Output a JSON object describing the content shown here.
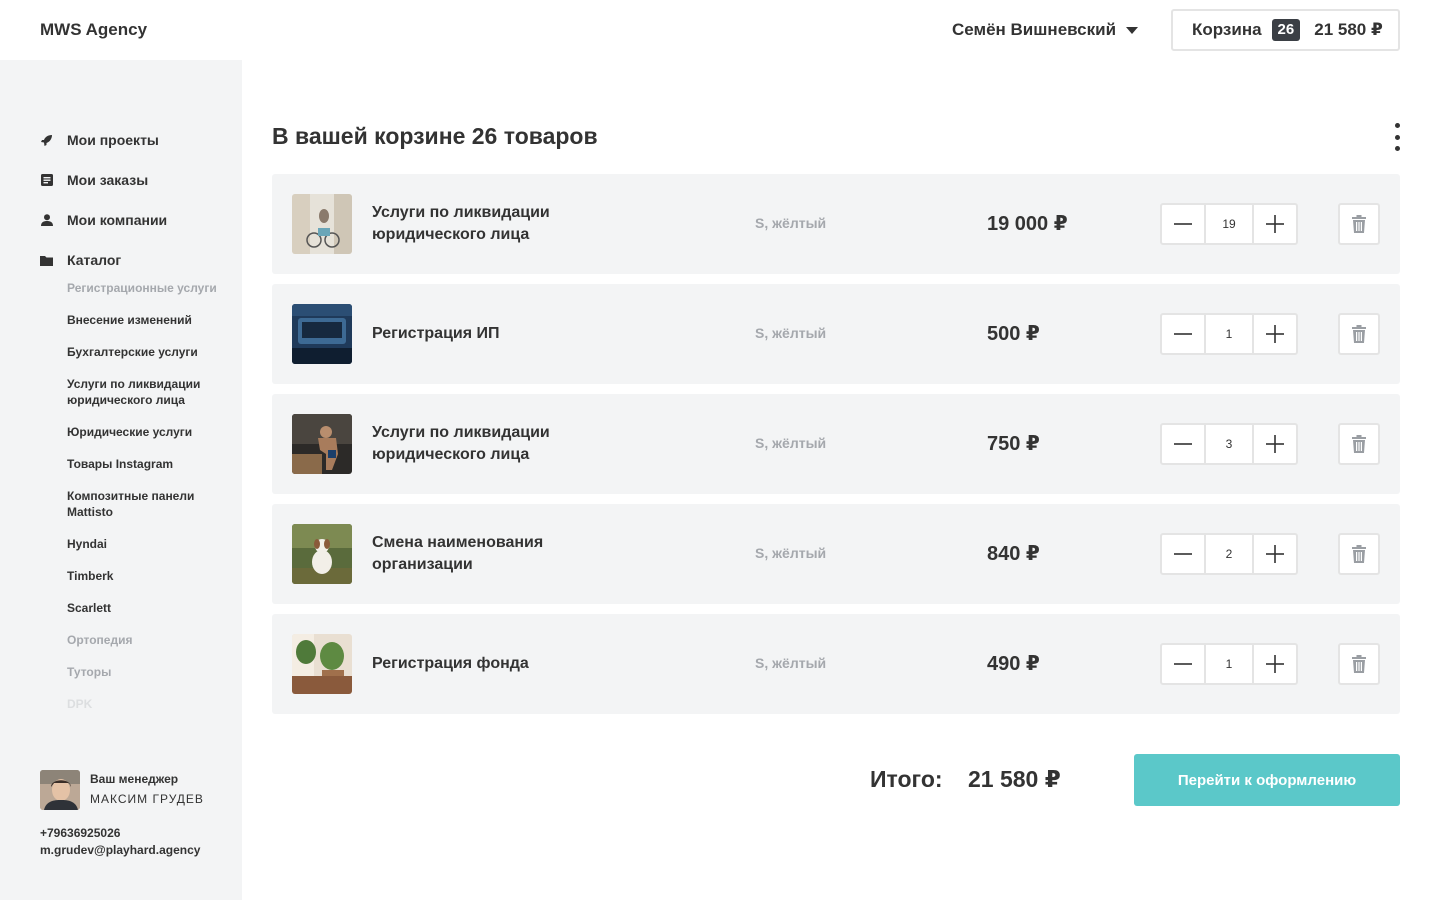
{
  "header": {
    "brand": "MWS Agency",
    "user_name": "Семён Вишневский",
    "cart_label": "Корзина",
    "cart_count": "26",
    "cart_total": "21 580 ₽"
  },
  "sidebar": {
    "nav": [
      {
        "label": "Мои проекты",
        "icon": "rocket-icon"
      },
      {
        "label": "Мои заказы",
        "icon": "document-icon"
      },
      {
        "label": "Мои компании",
        "icon": "user-icon"
      },
      {
        "label": "Каталог",
        "icon": "folder-icon"
      }
    ],
    "catalog": [
      "Регистрационные услуги",
      "Внесение изменений",
      "Бухгалтерские услуги",
      "Услуги по ликвидации юридического лица",
      "Юридические услуги",
      "Товары Instagram",
      "Композитные панели Mattisto",
      "Hyndai",
      "Timberk",
      "Scarlett",
      "Ортопедия",
      "Туторы",
      "DPK"
    ],
    "manager": {
      "label": "Ваш менеджер",
      "name": "МАКСИМ ГРУДЕВ",
      "phone": "+79636925026",
      "email": "m.grudev@playhard.agency"
    }
  },
  "main": {
    "title": "В вашей корзине 26 товаров",
    "items": [
      {
        "name": "Услуги по ликвидации юридического лица",
        "variant": "S, жёлтый",
        "price": "19 000 ₽",
        "qty": "19"
      },
      {
        "name": "Регистрация ИП",
        "variant": "S, жёлтый",
        "price": "500 ₽",
        "qty": "1"
      },
      {
        "name": "Услуги по ликвидации юридического лица",
        "variant": "S, жёлтый",
        "price": "750 ₽",
        "qty": "3"
      },
      {
        "name": "Смена наименования организации",
        "variant": "S, жёлтый",
        "price": "840 ₽",
        "qty": "2"
      },
      {
        "name": "Регистрация фонда",
        "variant": "S, жёлтый",
        "price": "490 ₽",
        "qty": "1"
      }
    ],
    "total_label": "Итого:",
    "total_value": "21 580 ₽",
    "checkout_label": "Перейти к оформлению"
  },
  "colors": {
    "accent": "#5bc8c9",
    "text": "#333333",
    "muted": "#a5a8ad",
    "panel": "#f3f4f5",
    "badge": "#3b3f45"
  }
}
